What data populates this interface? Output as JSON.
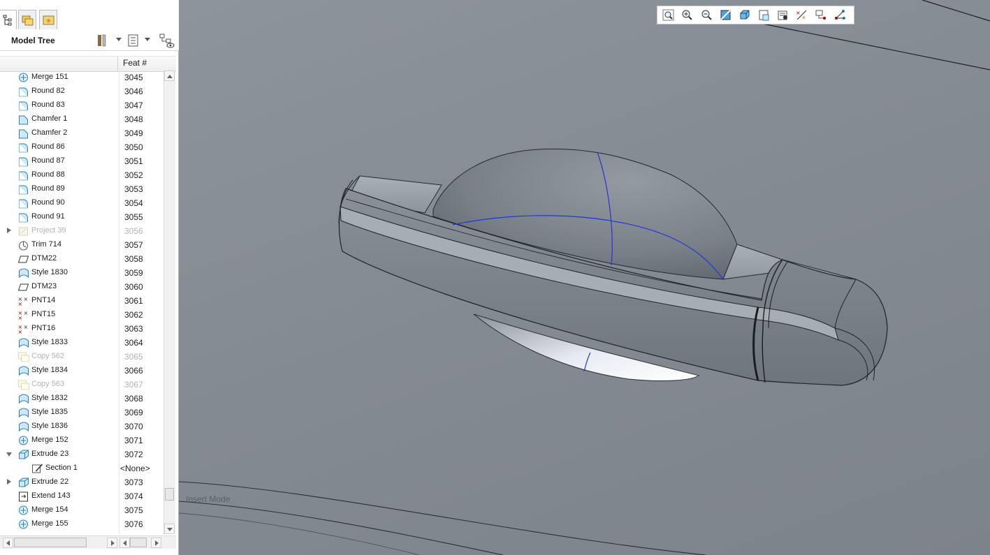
{
  "panel": {
    "title": "Model Tree",
    "tabs": [
      {
        "name": "model-tree-tab",
        "icon": "model-tree-icon"
      },
      {
        "name": "folder-browser-tab",
        "icon": "folder-browser-icon"
      },
      {
        "name": "favorites-tab",
        "icon": "favorites-icon"
      }
    ],
    "column_header": "Feat #"
  },
  "tree": [
    {
      "label": "Merge 151",
      "feat": "3045",
      "icon": "merge-icon"
    },
    {
      "label": "Round 82",
      "feat": "3046",
      "icon": "round-icon"
    },
    {
      "label": "Round 83",
      "feat": "3047",
      "icon": "round-icon"
    },
    {
      "label": "Chamfer 1",
      "feat": "3048",
      "icon": "chamfer-icon"
    },
    {
      "label": "Chamfer 2",
      "feat": "3049",
      "icon": "chamfer-icon"
    },
    {
      "label": "Round 86",
      "feat": "3050",
      "icon": "round-icon"
    },
    {
      "label": "Round 87",
      "feat": "3051",
      "icon": "round-icon"
    },
    {
      "label": "Round 88",
      "feat": "3052",
      "icon": "round-icon"
    },
    {
      "label": "Round 89",
      "feat": "3053",
      "icon": "round-icon"
    },
    {
      "label": "Round 90",
      "feat": "3054",
      "icon": "round-icon"
    },
    {
      "label": "Round 91",
      "feat": "3055",
      "icon": "round-icon"
    },
    {
      "label": "Project 39",
      "feat": "3056",
      "icon": "project-icon",
      "dim": true,
      "expand": "collapsed"
    },
    {
      "label": "Trim 714",
      "feat": "3057",
      "icon": "trim-icon"
    },
    {
      "label": "DTM22",
      "feat": "3058",
      "icon": "datum-plane-icon"
    },
    {
      "label": "Style 1830",
      "feat": "3059",
      "icon": "style-icon"
    },
    {
      "label": "DTM23",
      "feat": "3060",
      "icon": "datum-plane-icon"
    },
    {
      "label": "PNT14",
      "feat": "3061",
      "icon": "datum-point-icon"
    },
    {
      "label": "PNT15",
      "feat": "3062",
      "icon": "datum-point-icon"
    },
    {
      "label": "PNT16",
      "feat": "3063",
      "icon": "datum-point-icon"
    },
    {
      "label": "Style 1833",
      "feat": "3064",
      "icon": "style-icon"
    },
    {
      "label": "Copy 562",
      "feat": "3065",
      "icon": "copy-icon",
      "dim": true
    },
    {
      "label": "Style 1834",
      "feat": "3066",
      "icon": "style-icon"
    },
    {
      "label": "Copy 563",
      "feat": "3067",
      "icon": "copy-icon",
      "dim": true
    },
    {
      "label": "Style 1832",
      "feat": "3068",
      "icon": "style-icon"
    },
    {
      "label": "Style 1835",
      "feat": "3069",
      "icon": "style-icon"
    },
    {
      "label": "Style 1836",
      "feat": "3070",
      "icon": "style-icon"
    },
    {
      "label": "Merge 152",
      "feat": "3071",
      "icon": "merge-icon"
    },
    {
      "label": "Extrude 23",
      "feat": "3072",
      "icon": "extrude-icon",
      "expand": "expanded"
    },
    {
      "label": "Section 1",
      "feat": "<None>",
      "icon": "sketch-icon",
      "child": true
    },
    {
      "label": "Extrude 22",
      "feat": "3073",
      "icon": "extrude-icon",
      "expand": "collapsed"
    },
    {
      "label": "Extend 143",
      "feat": "3074",
      "icon": "extend-icon"
    },
    {
      "label": "Merge 154",
      "feat": "3075",
      "icon": "merge-icon"
    },
    {
      "label": "Merge 155",
      "feat": "3076",
      "icon": "merge-icon"
    }
  ],
  "viewport": {
    "status_text": "Insert Mode",
    "toolbar": [
      "zoom-fit-icon",
      "zoom-in-icon",
      "zoom-out-icon",
      "repaint-icon",
      "display-style-icon",
      "saved-views-icon",
      "view-manager-icon",
      "datum-display-icon",
      "spin-center-icon",
      "annotation-display-icon"
    ]
  },
  "colors": {
    "viewport_bg": "#878d94",
    "curve_blue": "#2236d8",
    "selection_blue": "#4a90d9"
  }
}
